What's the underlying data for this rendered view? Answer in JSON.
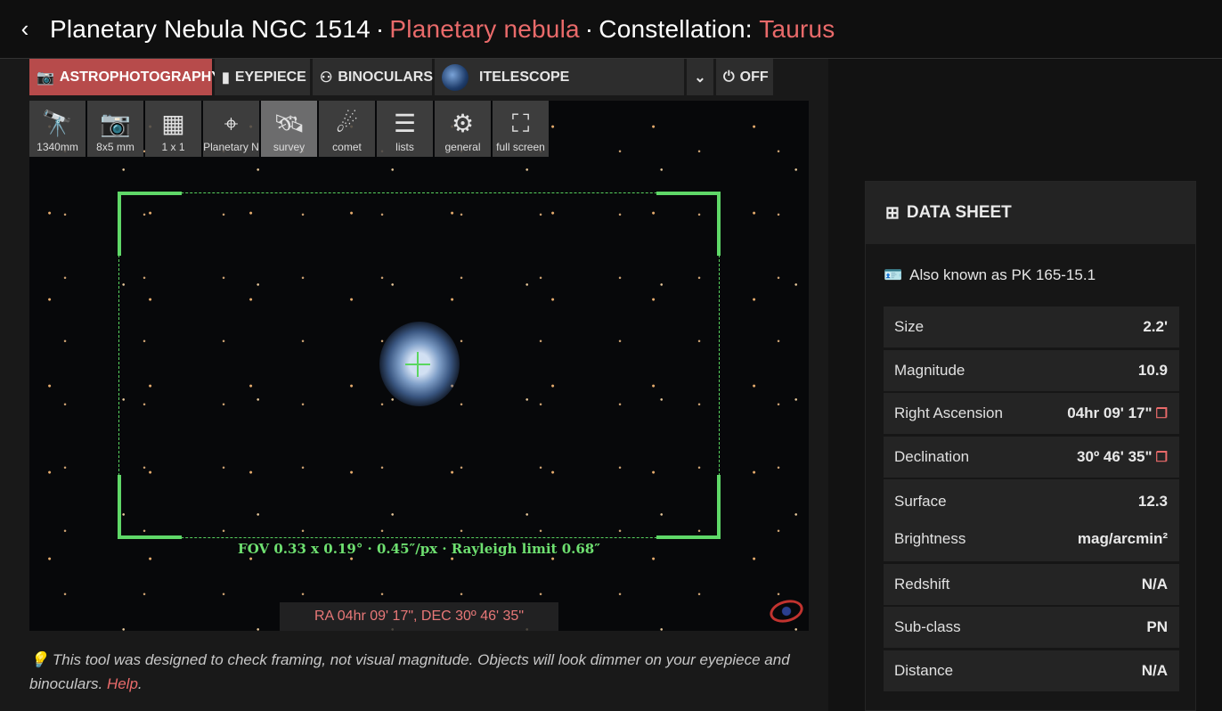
{
  "header": {
    "back_glyph": "‹",
    "object_name": "Planetary Nebula NGC 1514",
    "object_type": "Planetary nebula",
    "constellation_label": "Constellation:",
    "constellation": "Taurus"
  },
  "modes": [
    {
      "icon": "camera-icon",
      "glyph": "📷",
      "label": "ASTROPHOTOGRAPHY",
      "active": true
    },
    {
      "icon": "eyepiece-icon",
      "glyph": "▮",
      "label": "EYEPIECE"
    },
    {
      "icon": "binoculars-icon",
      "glyph": "⚇",
      "label": "BINOCULARS"
    },
    {
      "icon": "itelescope-icon",
      "label": "ITELESCOPE"
    },
    {
      "icon": "chevron-down-icon",
      "glyph": "⌄",
      "label": ""
    },
    {
      "icon": "power-icon",
      "glyph": "⏻",
      "label": "OFF"
    }
  ],
  "tools": [
    {
      "icon": "telescope-icon",
      "glyph": "🔭",
      "label": "1340mm"
    },
    {
      "icon": "camera-icon",
      "glyph": "📷",
      "label": "8x5 mm"
    },
    {
      "icon": "grid-icon",
      "glyph": "▦",
      "label": "1 x 1"
    },
    {
      "icon": "crosshair-icon",
      "glyph": "⌖",
      "label": "Planetary N"
    },
    {
      "icon": "satellite-icon",
      "glyph": "🛰",
      "label": "survey",
      "active": true
    },
    {
      "icon": "comet-icon",
      "glyph": "☄",
      "label": "comet"
    },
    {
      "icon": "list-icon",
      "glyph": "☰",
      "label": "lists"
    },
    {
      "icon": "gear-icon",
      "glyph": "⚙",
      "label": "general"
    },
    {
      "icon": "expand-icon",
      "glyph": "⛶",
      "label": "full screen"
    }
  ],
  "viewer": {
    "fov_text": "FOV 0.33 x 0.19° · 0.45″/px · Rayleigh limit 0.68″",
    "coords": "RA 04hr 09' 17\", DEC 30º 46' 35\""
  },
  "note": {
    "icon": "lightbulb-icon",
    "glyph": "💡",
    "text": "This tool was designed to check framing, not visual magnitude. Objects will look dimmer on your eyepiece and binoculars. ",
    "link": "Help",
    "tail": "."
  },
  "datasheet": {
    "icon": "table-icon",
    "glyph": "⊞",
    "title": "DATA SHEET",
    "aka_icon": "id-card-icon",
    "aka_glyph": "🪪",
    "aka": "Also known as PK 165-15.1",
    "rows": [
      {
        "key": "Size",
        "value": "2.2'"
      },
      {
        "key": "Magnitude",
        "value": "10.9"
      },
      {
        "key": "Right Ascension",
        "value": "04hr 09' 17\"",
        "copy": true
      },
      {
        "key": "Declination",
        "value": "30º 46' 35\"",
        "copy": true
      },
      {
        "key": "Surface",
        "value": "12.3",
        "key2": "Brightness",
        "value2": "mag/arcmin²"
      },
      {
        "key": "Redshift",
        "value": "N/A"
      },
      {
        "key": "Sub-class",
        "value": "PN"
      },
      {
        "key": "Distance",
        "value": "N/A"
      }
    ]
  },
  "colors": {
    "accent": "#e96a6a",
    "active_mode": "#b74b4b",
    "fov_green": "#5fd868"
  }
}
